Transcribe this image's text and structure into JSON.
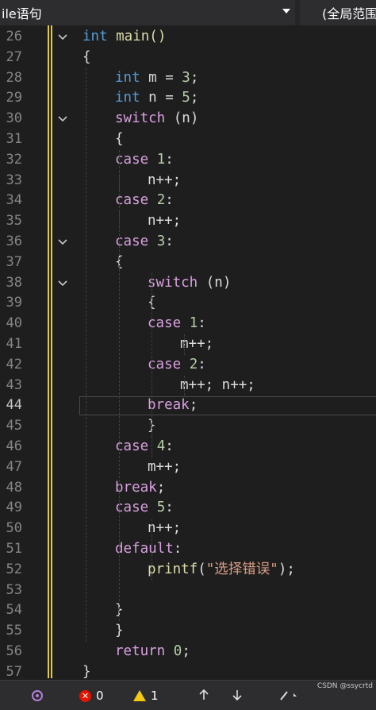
{
  "toolbar": {
    "scope_dropdown": "ile语句",
    "global_dropdown": "(全局范围"
  },
  "editor": {
    "current_line": "44",
    "lines": [
      {
        "n": "26",
        "indent": 0,
        "tokens": [
          {
            "t": "int",
            "c": "kw"
          },
          {
            "t": " main()",
            "c": "fn0"
          }
        ],
        "fold": true
      },
      {
        "n": "27",
        "indent": 0,
        "tokens": [
          {
            "t": "{",
            "c": ""
          }
        ]
      },
      {
        "n": "28",
        "indent": 1,
        "tokens": [
          {
            "t": "int",
            "c": "kw"
          },
          {
            "t": " m = ",
            "c": ""
          },
          {
            "t": "3",
            "c": "num"
          },
          {
            "t": ";",
            "c": ""
          }
        ]
      },
      {
        "n": "29",
        "indent": 1,
        "tokens": [
          {
            "t": "int",
            "c": "kw"
          },
          {
            "t": " n = ",
            "c": ""
          },
          {
            "t": "5",
            "c": "num"
          },
          {
            "t": ";",
            "c": ""
          }
        ]
      },
      {
        "n": "30",
        "indent": 1,
        "tokens": [
          {
            "t": "switch",
            "c": "ctl"
          },
          {
            "t": " (n)",
            "c": ""
          }
        ],
        "fold": true
      },
      {
        "n": "31",
        "indent": 1,
        "tokens": [
          {
            "t": "{",
            "c": ""
          }
        ]
      },
      {
        "n": "32",
        "indent": 1,
        "tokens": [
          {
            "t": "case",
            "c": "ctl"
          },
          {
            "t": " ",
            "c": ""
          },
          {
            "t": "1",
            "c": "num"
          },
          {
            "t": ":",
            "c": ""
          }
        ]
      },
      {
        "n": "33",
        "indent": 2,
        "tokens": [
          {
            "t": "n++;",
            "c": ""
          }
        ]
      },
      {
        "n": "34",
        "indent": 1,
        "tokens": [
          {
            "t": "case",
            "c": "ctl"
          },
          {
            "t": " ",
            "c": ""
          },
          {
            "t": "2",
            "c": "num"
          },
          {
            "t": ":",
            "c": ""
          }
        ]
      },
      {
        "n": "35",
        "indent": 2,
        "tokens": [
          {
            "t": "n++;",
            "c": ""
          }
        ]
      },
      {
        "n": "36",
        "indent": 1,
        "tokens": [
          {
            "t": "case",
            "c": "ctl"
          },
          {
            "t": " ",
            "c": ""
          },
          {
            "t": "3",
            "c": "num"
          },
          {
            "t": ":",
            "c": ""
          }
        ],
        "fold": true
      },
      {
        "n": "37",
        "indent": 1,
        "tokens": [
          {
            "t": "{",
            "c": ""
          }
        ]
      },
      {
        "n": "38",
        "indent": 2,
        "tokens": [
          {
            "t": "switch",
            "c": "ctl"
          },
          {
            "t": " (n)",
            "c": ""
          }
        ],
        "fold": true
      },
      {
        "n": "39",
        "indent": 2,
        "tokens": [
          {
            "t": "{",
            "c": ""
          }
        ]
      },
      {
        "n": "40",
        "indent": 2,
        "tokens": [
          {
            "t": "case",
            "c": "ctl"
          },
          {
            "t": " ",
            "c": ""
          },
          {
            "t": "1",
            "c": "num"
          },
          {
            "t": ":",
            "c": ""
          }
        ]
      },
      {
        "n": "41",
        "indent": 3,
        "tokens": [
          {
            "t": "m++;",
            "c": ""
          }
        ]
      },
      {
        "n": "42",
        "indent": 2,
        "tokens": [
          {
            "t": "case",
            "c": "ctl"
          },
          {
            "t": " ",
            "c": ""
          },
          {
            "t": "2",
            "c": "num"
          },
          {
            "t": ":",
            "c": ""
          }
        ]
      },
      {
        "n": "43",
        "indent": 3,
        "tokens": [
          {
            "t": "m++; n++;",
            "c": ""
          }
        ]
      },
      {
        "n": "44",
        "indent": 2,
        "tokens": [
          {
            "t": "break",
            "c": "ctl"
          },
          {
            "t": ";",
            "c": ""
          }
        ]
      },
      {
        "n": "45",
        "indent": 2,
        "tokens": [
          {
            "t": "}",
            "c": ""
          }
        ]
      },
      {
        "n": "46",
        "indent": 1,
        "tokens": [
          {
            "t": "case",
            "c": "ctl"
          },
          {
            "t": " ",
            "c": ""
          },
          {
            "t": "4",
            "c": "num"
          },
          {
            "t": ":",
            "c": ""
          }
        ]
      },
      {
        "n": "47",
        "indent": 2,
        "tokens": [
          {
            "t": "m++;",
            "c": ""
          }
        ]
      },
      {
        "n": "48",
        "indent": 1,
        "tokens": [
          {
            "t": "break",
            "c": "ctl"
          },
          {
            "t": ";",
            "c": ""
          }
        ]
      },
      {
        "n": "49",
        "indent": 1,
        "tokens": [
          {
            "t": "case",
            "c": "ctl"
          },
          {
            "t": " ",
            "c": ""
          },
          {
            "t": "5",
            "c": "num"
          },
          {
            "t": ":",
            "c": ""
          }
        ]
      },
      {
        "n": "50",
        "indent": 2,
        "tokens": [
          {
            "t": "n++;",
            "c": ""
          }
        ]
      },
      {
        "n": "51",
        "indent": 1,
        "tokens": [
          {
            "t": "default",
            "c": "ctl"
          },
          {
            "t": ":",
            "c": ""
          }
        ]
      },
      {
        "n": "52",
        "indent": 2,
        "tokens": [
          {
            "t": "printf",
            "c": "fn"
          },
          {
            "t": "(",
            "c": ""
          },
          {
            "t": "\"选择错误\"",
            "c": "str"
          },
          {
            "t": ");",
            "c": ""
          }
        ]
      },
      {
        "n": "53",
        "indent": 2,
        "tokens": []
      },
      {
        "n": "54",
        "indent": 1,
        "tokens": [
          {
            "t": "}",
            "c": ""
          }
        ]
      },
      {
        "n": "55",
        "indent": 1,
        "tokens": [
          {
            "t": "}",
            "c": ""
          }
        ]
      },
      {
        "n": "56",
        "indent": 1,
        "tokens": [
          {
            "t": "return",
            "c": "ctl"
          },
          {
            "t": " ",
            "c": ""
          },
          {
            "t": "0",
            "c": "num"
          },
          {
            "t": ";",
            "c": ""
          }
        ]
      },
      {
        "n": "57",
        "indent": 0,
        "tokens": [
          {
            "t": "}",
            "c": ""
          }
        ]
      }
    ]
  },
  "status": {
    "errors": "0",
    "warnings": "1",
    "watermark": "CSDN @ssycrtd"
  }
}
